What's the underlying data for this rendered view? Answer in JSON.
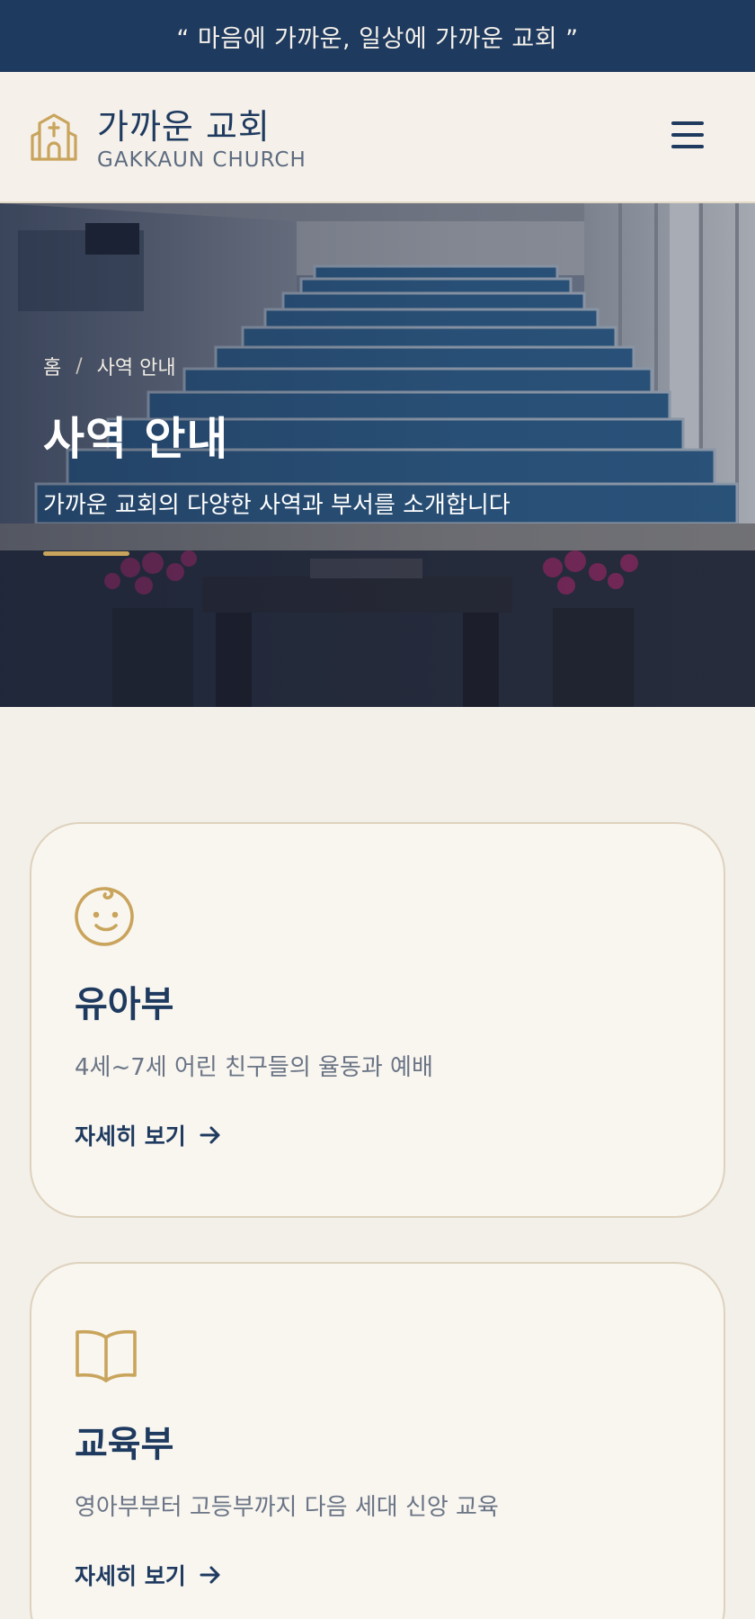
{
  "banner": {
    "text": "“ 마음에 가까운, 일상에 가까운 교회 ”"
  },
  "header": {
    "name": "가까운 교회",
    "subtitle": "GAKKAUN CHURCH",
    "logo_icon": "church-icon",
    "menu_icon": "hamburger-menu-icon"
  },
  "hero": {
    "breadcrumb": [
      "홈",
      "/",
      "사역 안내"
    ],
    "title": "사역 안내",
    "description": "가까운 교회의 다양한 사역과 부서를 소개합니다"
  },
  "cards": [
    {
      "icon": "baby-face-icon",
      "title": "유아부",
      "description": "4세~7세 어린 친구들의 율동과 예배",
      "link": "자세히 보기"
    },
    {
      "icon": "open-book-icon",
      "title": "교육부",
      "description": "영아부부터 고등부까지 다음 세대 신앙 교육",
      "link": "자세히 보기"
    }
  ],
  "colors": {
    "navy": "#1f3a5f",
    "gold": "#c9a45c",
    "background": "#f3efe9",
    "card": "#f9f6f0"
  }
}
